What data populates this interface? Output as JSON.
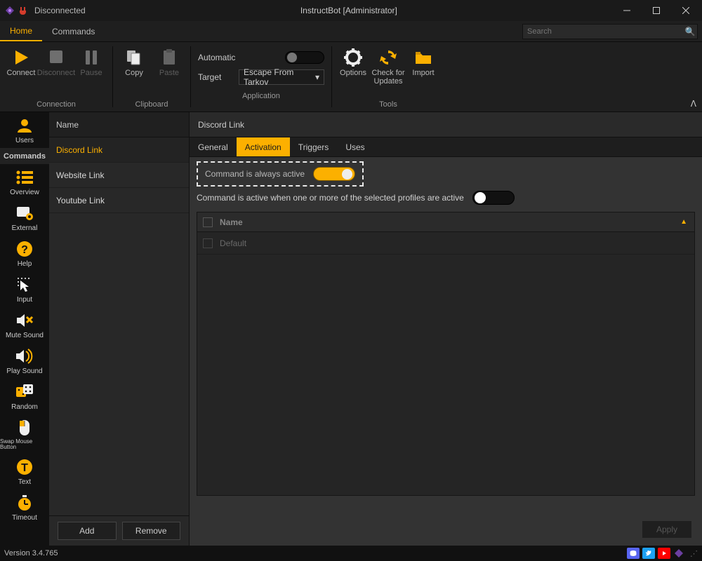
{
  "titlebar": {
    "status": "Disconnected",
    "title": "InstructBot [Administrator]"
  },
  "tabs": {
    "home": "Home",
    "commands": "Commands",
    "search_placeholder": "Search"
  },
  "ribbon": {
    "connect": "Connect",
    "disconnect": "Disconnect",
    "pause": "Pause",
    "copy": "Copy",
    "paste": "Paste",
    "automatic": "Automatic",
    "target": "Target",
    "target_value": "Escape From Tarkov",
    "options": "Options",
    "check": "Check for Updates",
    "import": "Import",
    "groups": {
      "connection": "Connection",
      "clipboard": "Clipboard",
      "application": "Application",
      "tools": "Tools"
    }
  },
  "leftnav": {
    "users": "Users",
    "commands": "Commands",
    "overview": "Overview",
    "external": "External",
    "help": "Help",
    "input": "Input",
    "mute": "Mute Sound",
    "play": "Play Sound",
    "random": "Random",
    "swap": "Swap Mouse Button",
    "text": "Text",
    "timeout": "Timeout"
  },
  "list": {
    "header": "Name",
    "items": [
      "Discord Link",
      "Website Link",
      "Youtube Link"
    ],
    "add": "Add",
    "remove": "Remove"
  },
  "main": {
    "title": "Discord Link",
    "tabs": {
      "general": "General",
      "activation": "Activation",
      "triggers": "Triggers",
      "uses": "Uses"
    },
    "opt1": "Command is always active",
    "opt2": "Command is active when one or more of the selected profiles are active",
    "table": {
      "header": "Name",
      "rows": [
        "Default"
      ]
    },
    "apply": "Apply"
  },
  "status": {
    "version": "Version 3.4.765"
  }
}
